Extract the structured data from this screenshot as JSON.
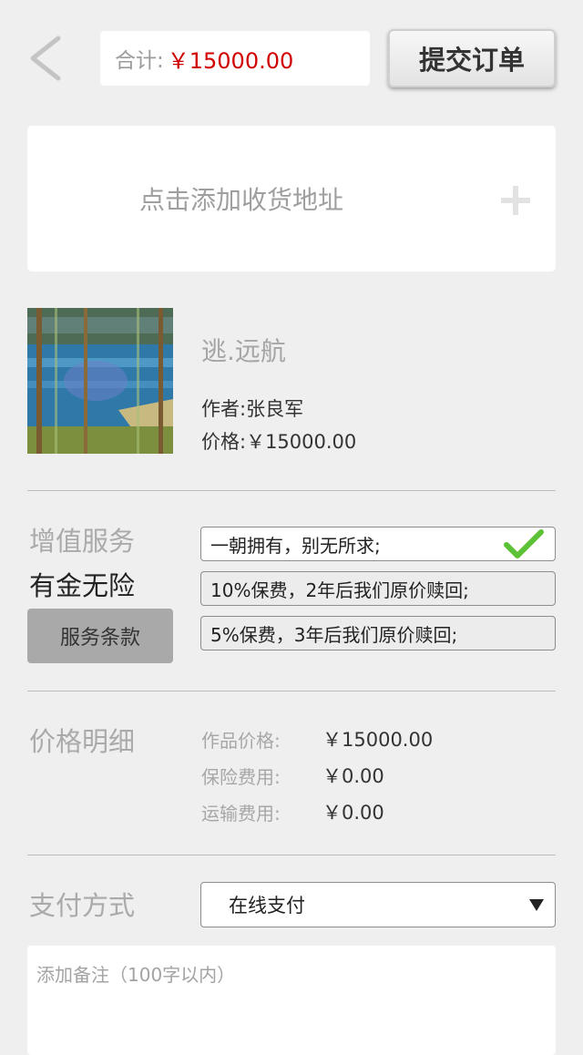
{
  "header": {
    "total_label": "合计:",
    "total_value": "￥15000.00",
    "submit_label": "提交订单"
  },
  "address": {
    "add_label": "点击添加收货地址"
  },
  "artwork": {
    "title": "逃.远航",
    "author": "作者:张良军",
    "price": "价格:￥15000.00"
  },
  "service": {
    "section_title": "增值服务",
    "plan_name": "有金无险",
    "terms_label": "服务条款",
    "options": [
      {
        "label": "一朝拥有，别无所求;",
        "selected": true
      },
      {
        "label": "10%保费，2年后我们原价赎回;",
        "selected": false
      },
      {
        "label": "5%保费，3年后我们原价赎回;",
        "selected": false
      }
    ]
  },
  "price_detail": {
    "section_title": "价格明细",
    "rows": [
      {
        "label": "作品价格:",
        "value": "￥15000.00"
      },
      {
        "label": "保险费用:",
        "value": "￥0.00"
      },
      {
        "label": "运输费用:",
        "value": "￥0.00"
      }
    ]
  },
  "payment": {
    "section_title": "支付方式",
    "selected": "在线支付"
  },
  "notes": {
    "placeholder": "添加备注（100字以内）"
  },
  "colors": {
    "accent_red": "#d10000",
    "check_green": "#5bc236",
    "background": "#efefef"
  }
}
